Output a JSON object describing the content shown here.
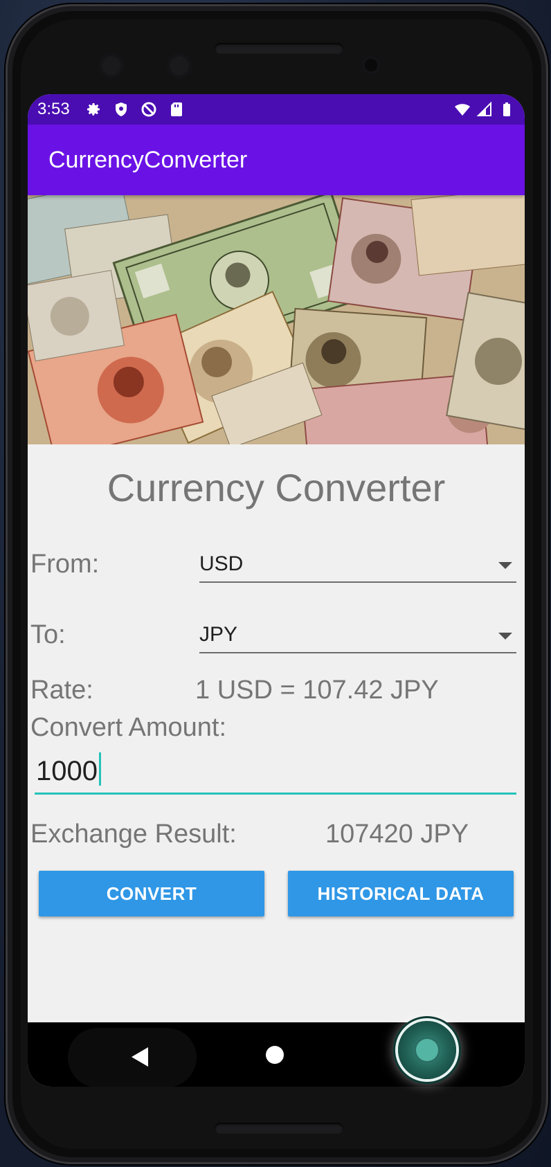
{
  "status_bar": {
    "time": "3:53",
    "left_icons": [
      "gear-icon",
      "shield-icon",
      "no-sign-icon",
      "sd-card-icon"
    ],
    "right_icons": [
      "wifi-icon",
      "signal-icon",
      "battery-icon"
    ]
  },
  "app_bar": {
    "title": "CurrencyConverter"
  },
  "main": {
    "heading": "Currency Converter",
    "from_label": "From:",
    "from_value": "USD",
    "to_label": "To:",
    "to_value": "JPY",
    "rate_label": "Rate:",
    "rate_value": "1 USD = 107.42 JPY",
    "amount_label": "Convert Amount:",
    "amount_value": "1000",
    "result_label": "Exchange Result:",
    "result_value": "107420 JPY",
    "convert_button": "CONVERT",
    "historical_button": "HISTORICAL DATA"
  },
  "colors": {
    "status_bar": "#4a0db2",
    "app_bar": "#6a12e6",
    "button": "#2f97e6",
    "input_underline": "#22c3b8"
  }
}
